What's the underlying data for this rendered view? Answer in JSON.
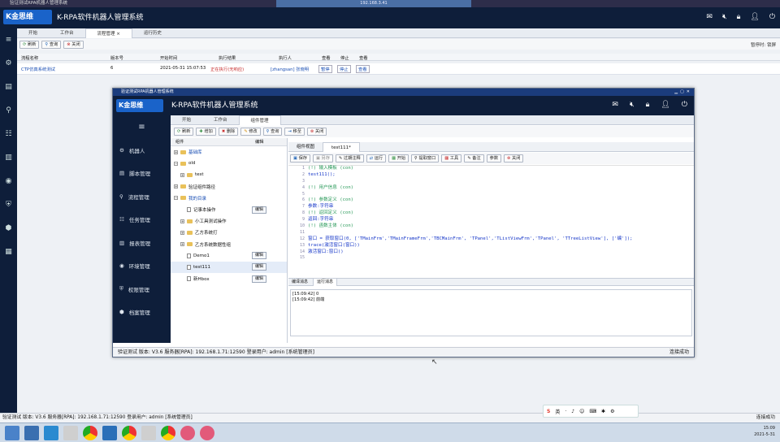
{
  "outer_window": {
    "title": "验证测试RPA机器人管理系统",
    "remote_bar": "192.168.3.41",
    "app_title": "K-RPA软件机器人管理系统",
    "logo_text": "金思维",
    "tabs": [
      {
        "label": "开始"
      },
      {
        "label": "工作台"
      },
      {
        "label": "流程管理"
      },
      {
        "label": "运行历史"
      }
    ],
    "active_tab_close": "×",
    "toolbar": {
      "refresh": "刷新",
      "query": "查询",
      "close": "关闭"
    },
    "right_label": "暂停时: 锁屏",
    "grid_headers": [
      "流程名称",
      "版本号",
      "开始时间",
      "执行结果",
      "执行人",
      "查看",
      "停止",
      "查看"
    ],
    "grid_row": [
      "CTP仿真系统测试",
      "6",
      "2021-05-31 15:07:53",
      "正在执行(无响应)",
      "[zhangsan] 张晓明",
      "暂停",
      "停止",
      "查看"
    ],
    "status": {
      "left": "验证测试  版本: V3.6  服务器[RPA]: 192.168.1.71:12590  登录用户: admin [系统管理员]",
      "right": "连接成功"
    }
  },
  "inner_window": {
    "title": "验证测试RPA机器人管理系统",
    "app_title": "K-RPA软件机器人管理系统",
    "logo_text": "金思维",
    "sidebar": [
      {
        "label": "机器人",
        "icon": "robot-icon"
      },
      {
        "label": "脚本管理",
        "icon": "script-icon"
      },
      {
        "label": "流程管理",
        "icon": "flow-icon"
      },
      {
        "label": "任务管理",
        "icon": "task-icon"
      },
      {
        "label": "报表管理",
        "icon": "report-icon"
      },
      {
        "label": "环境管理",
        "icon": "env-icon"
      },
      {
        "label": "权限管理",
        "icon": "permission-icon"
      },
      {
        "label": "档案管理",
        "icon": "archive-icon"
      }
    ],
    "tabs": [
      {
        "label": "开始"
      },
      {
        "label": "工作台"
      },
      {
        "label": "组件管理"
      }
    ],
    "toolbar": {
      "refresh": "刷新",
      "add": "增加",
      "delete": "删除",
      "modify": "修改",
      "query": "查询",
      "move": "移至",
      "close": "关闭"
    },
    "tree_headers": [
      "组件",
      "编辑"
    ],
    "tree": [
      {
        "label": "基础库",
        "kind": "folder",
        "level": 0,
        "edit": ""
      },
      {
        "label": "old",
        "kind": "folder",
        "level": 0,
        "edit": ""
      },
      {
        "label": "test",
        "kind": "folder",
        "level": 1,
        "edit": ""
      },
      {
        "label": "验证组件路径",
        "kind": "folder",
        "level": 0,
        "edit": ""
      },
      {
        "label": "我的目录",
        "kind": "folder",
        "level": 0,
        "edit": ""
      },
      {
        "label": "记事本操作",
        "kind": "file",
        "level": 1,
        "edit": "编辑"
      },
      {
        "label": "小工具测试操作",
        "kind": "folder",
        "level": 1,
        "edit": ""
      },
      {
        "label": "乙方系统打",
        "kind": "folder",
        "level": 1,
        "edit": ""
      },
      {
        "label": "乙方系统数据性组",
        "kind": "folder",
        "level": 1,
        "edit": ""
      },
      {
        "label": "Demo1",
        "kind": "file",
        "level": 1,
        "edit": "编辑"
      },
      {
        "label": "test111",
        "kind": "file",
        "level": 1,
        "edit": "编辑"
      },
      {
        "label": "新Hbox",
        "kind": "file",
        "level": 1,
        "edit": "编辑"
      }
    ],
    "editor_tabs": [
      {
        "label": "组件视图"
      },
      {
        "label": "test111*"
      }
    ],
    "editor_toolbar": [
      "保存",
      "另存",
      "过期注释",
      "运行",
      "开始",
      "提取窗口",
      "工具",
      "备注",
      "参数",
      "关闭"
    ],
    "code_lines": [
      {
        "n": "1",
        "text": "(!) 输入模板 (con)",
        "type": "comment"
      },
      {
        "n": "2",
        "text": "test111();",
        "type": "code"
      },
      {
        "n": "3",
        "text": "",
        "type": "code"
      },
      {
        "n": "4",
        "text": "(!) 用户信息 (con)",
        "type": "comment"
      },
      {
        "n": "5",
        "text": "",
        "type": "code"
      },
      {
        "n": "6",
        "text": "(!) 参数定义 (con)",
        "type": "comment"
      },
      {
        "n": "7",
        "text": "参数:字符串",
        "type": "code"
      },
      {
        "n": "8",
        "text": "(!) 返回定义 (con)",
        "type": "comment"
      },
      {
        "n": "9",
        "text": "返回:字符串",
        "type": "code"
      },
      {
        "n": "10",
        "text": "(!) 函数主体 (con)",
        "type": "comment"
      },
      {
        "n": "11",
        "text": "",
        "type": "code"
      },
      {
        "n": "12",
        "text": "窗口 = 获取窗口(0, ['TMainFrm','TMainFrameFrm','TBCMainFrm', 'TPanel','TListViewFrm','TPanel', 'TTreeListView'], ['编']);",
        "type": "code"
      },
      {
        "n": "13",
        "text": "trace(激活窗口(窗口))",
        "type": "code"
      },
      {
        "n": "14",
        "text": "激活窗口:窗口()",
        "type": "code"
      },
      {
        "n": "15",
        "text": "",
        "type": "code"
      }
    ],
    "output_tabs": [
      {
        "label": "编译消息"
      },
      {
        "label": "运行消息"
      }
    ],
    "output_log": [
      "[15:09:42] 0",
      "[15:09:42] 前端"
    ],
    "status": {
      "left": "验证测试  版本: V3.6  服务器[RPA]: 192.168.1.71:12590  登录用户: admin [系统管理员]",
      "right": "连接成功"
    }
  },
  "tray": [
    "英",
    "·",
    "♪",
    "☺",
    "⌨",
    "✱",
    "⚙"
  ],
  "clock": {
    "time": "15:09",
    "date": "2021-5-31"
  }
}
